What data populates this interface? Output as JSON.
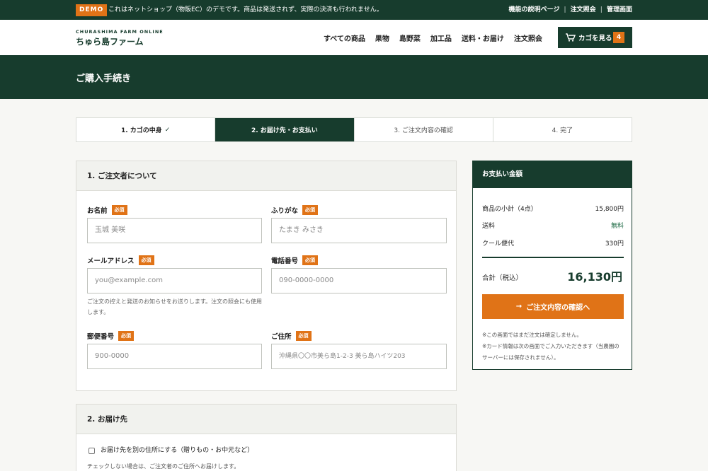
{
  "topbar": {
    "badge": "DEMO",
    "notice": "これはネットショップ（物販EC）のデモです。商品は発送されず、実際の決済も行われません。",
    "links": [
      "機能の説明ページ",
      "注文照会",
      "管理画面"
    ]
  },
  "header": {
    "logo_en": "CHURASHIMA FARM ONLINE",
    "logo_jp": "ちゅら島ファーム",
    "nav": [
      "すべての商品",
      "果物",
      "島野菜",
      "加工品",
      "送料・お届け",
      "注文照会"
    ],
    "cart_label": "カゴを見る",
    "cart_count": "4"
  },
  "page_title": "ご購入手続き",
  "steps": [
    "1. カゴの中身",
    "2. お届け先・お支払い",
    "3. ご注文内容の確認",
    "4. 完了"
  ],
  "steps_check": "✓",
  "orderer": {
    "title": "1. ご注文者について",
    "required": "必須",
    "name_label": "お名前",
    "name_placeholder": "玉城 美咲",
    "kana_label": "ふりがな",
    "kana_placeholder": "たまき みさき",
    "email_label": "メールアドレス",
    "email_placeholder": "you@example.com",
    "email_help": "ご注文の控えと発送のお知らせをお送りします。注文の照会にも使用します。",
    "tel_label": "電話番号",
    "tel_placeholder": "090-0000-0000",
    "zip_label": "郵便番号",
    "zip_placeholder": "900-0000",
    "address_label": "ご住所",
    "address_placeholder": "沖縄県〇〇市美ら島1-2-3 美ら島ハイツ203"
  },
  "delivery": {
    "title": "2. お届け先",
    "checkbox_label": "お届け先を別の住所にする（贈りもの・お中元など）",
    "help": "チェックしない場合は、ご注文者のご住所へお届けします。"
  },
  "summary": {
    "title": "お支払い金額",
    "subtotal_label": "商品の小計（4点）",
    "subtotal_value": "15,800円",
    "shipping_label": "送料",
    "shipping_value": "無料",
    "cool_label": "クール便代",
    "cool_value": "330円",
    "total_label": "合計（税込）",
    "total_value": "16,130円",
    "confirm_label": "ご注文内容の確認へ",
    "note1": "※この画面ではまだ注文は確定しません。",
    "note2": "※カード情報は次の画面でご入力いただきます（当農園のサーバーには保存されません）。"
  },
  "colors": {
    "primary": "#173c2d",
    "accent": "#e07317",
    "background": "#f7f7f4"
  }
}
